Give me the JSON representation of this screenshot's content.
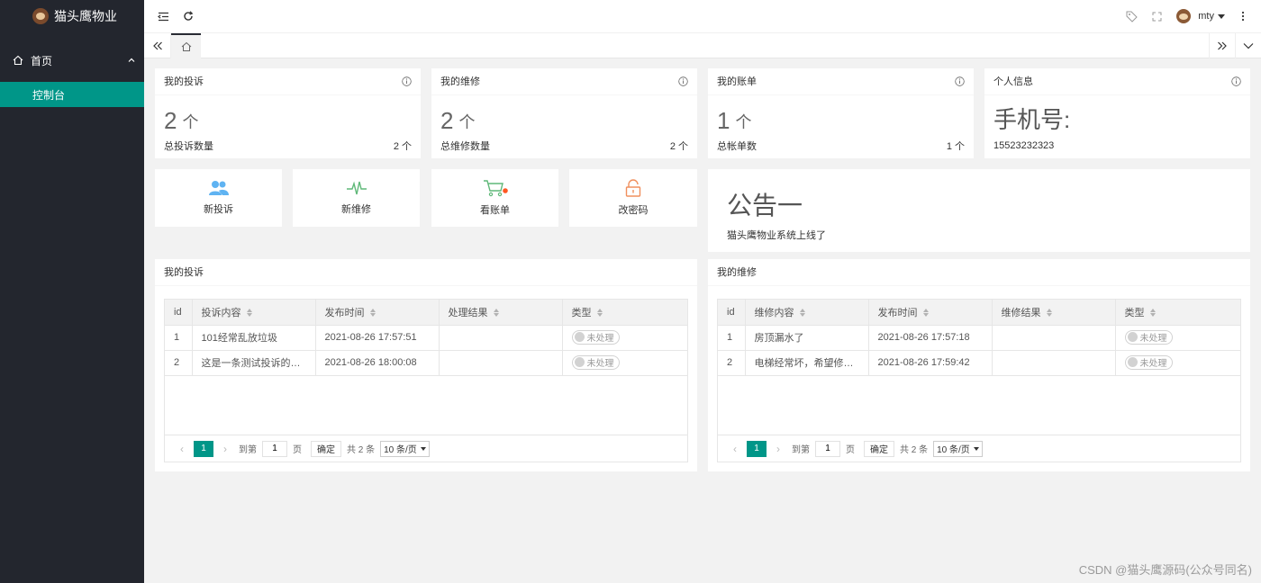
{
  "app": {
    "title": "猫头鹰物业"
  },
  "sidebar": {
    "group_label": "首页",
    "active_item": "控制台"
  },
  "header": {
    "username": "mty"
  },
  "stats": [
    {
      "title": "我的投诉",
      "value": "2",
      "unit": "个",
      "foot_label": "总投诉数量",
      "foot_value": "2 个"
    },
    {
      "title": "我的维修",
      "value": "2",
      "unit": "个",
      "foot_label": "总维修数量",
      "foot_value": "2 个"
    },
    {
      "title": "我的账单",
      "value": "1",
      "unit": "个",
      "foot_label": "总帐单数",
      "foot_value": "1 个"
    }
  ],
  "profile": {
    "title": "个人信息",
    "phone_label": "手机号:",
    "phone": "15523232323"
  },
  "shortcuts": [
    {
      "label": "新投诉",
      "icon": "users-icon",
      "color": "#5fb3f2"
    },
    {
      "label": "新维修",
      "icon": "pulse-icon",
      "color": "#5fb878"
    },
    {
      "label": "看账单",
      "icon": "cart-icon",
      "color": "#5fb878"
    },
    {
      "label": "改密码",
      "icon": "unlock-icon",
      "color": "#f0905e"
    }
  ],
  "notice": {
    "title": "公告一",
    "body": "猫头鹰物业系统上线了"
  },
  "complaints": {
    "title": "我的投诉",
    "columns": [
      "id",
      "投诉内容",
      "发布时间",
      "处理结果",
      "类型"
    ],
    "rows": [
      {
        "id": "1",
        "content": "101经常乱放垃圾",
        "time": "2021-08-26 17:57:51",
        "result": "",
        "type": "未处理"
      },
      {
        "id": "2",
        "content": "这是一条测试投诉的信...",
        "time": "2021-08-26 18:00:08",
        "result": "",
        "type": "未处理"
      }
    ]
  },
  "repairs": {
    "title": "我的维修",
    "columns": [
      "id",
      "维修内容",
      "发布时间",
      "维修结果",
      "类型"
    ],
    "rows": [
      {
        "id": "1",
        "content": "房顶漏水了",
        "time": "2021-08-26 17:57:18",
        "result": "",
        "type": "未处理"
      },
      {
        "id": "2",
        "content": "电梯经常坏，希望修一下",
        "time": "2021-08-26 17:59:42",
        "result": "",
        "type": "未处理"
      }
    ]
  },
  "pager": {
    "current": "1",
    "goto_label": "到第",
    "goto_value": "1",
    "page_label": "页",
    "confirm": "确定",
    "total": "共 2 条",
    "page_size": "10 条/页"
  },
  "watermark": "CSDN @猫头鹰源码(公众号同名)"
}
